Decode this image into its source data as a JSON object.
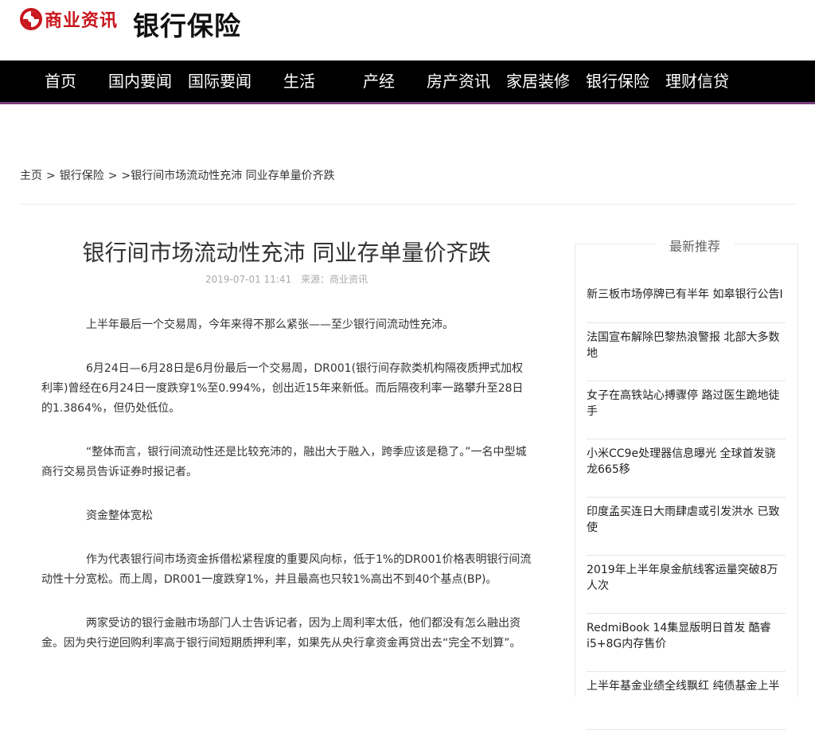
{
  "header": {
    "logo_text": "商业资讯",
    "channel_title": "银行保险"
  },
  "nav": {
    "items": [
      "首页",
      "国内要闻",
      "国际要闻",
      "生活",
      "产经",
      "房产资讯",
      "家居装修",
      "银行保险",
      "理财信贷"
    ]
  },
  "breadcrumb": {
    "home": "主页",
    "sep": ">",
    "category": "银行保险",
    "current": ">银行间市场流动性充沛 同业存单量价齐跌"
  },
  "article": {
    "title": "银行间市场流动性充沛 同业存单量价齐跌",
    "date": "2019-07-01 11:41",
    "source": "来源：商业资讯",
    "paragraphs": [
      "上半年最后一个交易周，今年来得不那么紧张——至少银行间流动性充沛。",
      "6月24日—6月28日是6月份最后一个交易周，DR001(银行间存款类机构隔夜质押式加权利率)曾经在6月24日一度跌穿1%至0.994%，创出近15年来新低。而后隔夜利率一路攀升至28日的1.3864%，但仍处低位。",
      "“整体而言，银行间流动性还是比较充沛的，融出大于融入，跨季应该是稳了。”一名中型城商行交易员告诉证券时报记者。",
      "资金整体宽松",
      "作为代表银行间市场资金拆借松紧程度的重要风向标，低于1%的DR001价格表明银行间流动性十分宽松。而上周，DR001一度跌穿1%，并且最高也只较1%高出不到40个基点(BP)。",
      "两家受访的银行金融市场部门人士告诉记者，因为上周利率太低，他们都没有怎么融出资金。因为央行逆回购利率高于银行间短期质押利率，如果先从央行拿资金再贷出去“完全不划算”。"
    ]
  },
  "sidebar": {
    "title": "最新推荐",
    "items": [
      "新三板市场停牌已有半年 如皋银行公告I",
      "法国宣布解除巴黎热浪警报 北部大多数地",
      "女子在高铁站心搏骤停 路过医生跪地徒手",
      "小米CC9e处理器信息曝光 全球首发骁龙665移",
      "印度孟买连日大雨肆虐或引发洪水 已致使",
      "2019年上半年泉金航线客运量突破8万人次",
      "RedmiBook 14集显版明日首发 酷睿i5+8G内存售价",
      "上半年基金业绩全线飘红 纯债基金上半"
    ]
  },
  "colors": {
    "brand_red": "#c8161d",
    "nav_bg": "#000000",
    "nav_accent": "#7a3b7d"
  }
}
